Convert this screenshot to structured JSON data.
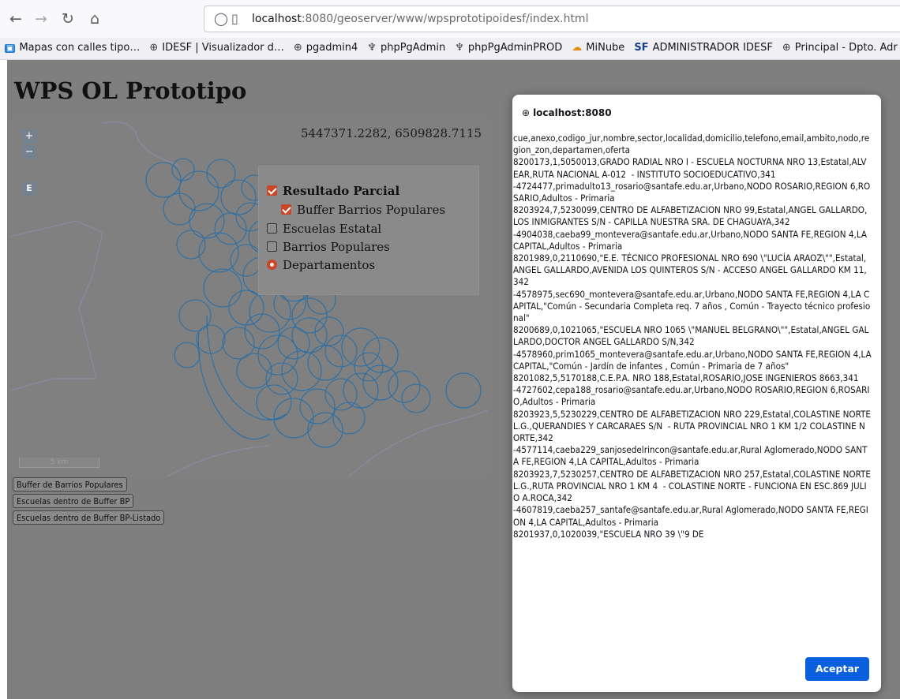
{
  "browser": {
    "url_host": "localhost",
    "url_rest": ":8080/geoserver/www/wpsprototipoidesf/index.html",
    "bookmarks": [
      {
        "label": "Mapas con calles tipo…",
        "icon": "mapas-icon"
      },
      {
        "label": "IDESF | Visualizador d…",
        "icon": "globe-icon"
      },
      {
        "label": "pgadmin4",
        "icon": "globe-icon"
      },
      {
        "label": "phpPgAdmin",
        "icon": "elephant-icon"
      },
      {
        "label": "phpPgAdminPROD",
        "icon": "elephant-icon"
      },
      {
        "label": "MiNube",
        "icon": "minube-icon"
      },
      {
        "label": "ADMINISTRADOR IDESF",
        "icon": "sf-icon"
      },
      {
        "label": "Principal - Dpto. Adr",
        "icon": "globe-icon"
      }
    ]
  },
  "page": {
    "title": "WPS OL Prototipo",
    "coords": "5447371.2282, 6509828.7115",
    "zoom_in": "+",
    "zoom_out": "−",
    "e_button": "E",
    "scale_label": "5 km",
    "layers": {
      "group": "Resultado Parcial",
      "items": [
        {
          "label": "Buffer Barrios Populares",
          "checked": true
        },
        {
          "label": "Escuelas Estatal",
          "checked": false
        },
        {
          "label": "Barrios Populares",
          "checked": false
        },
        {
          "label": "Departamentos",
          "selected": true
        }
      ]
    },
    "buttons": [
      "Buffer de Barrios Populares",
      "Escuelas dentro de Buffer BP",
      "Escuelas dentro de Buffer BP-Listado"
    ]
  },
  "dialog": {
    "host": "localhost:8080",
    "content": "cue,anexo,codigo_jur,nombre,sector,localidad,domicilio,telefono,email,ambito,nodo,region_zon,departamen,oferta\n8200173,1,5050013,GRADO RADIAL NRO I - ESCUELA NOCTURNA NRO 13,Estatal,ALVEAR,RUTA NACIONAL A-012  - INSTITUTO SOCIOEDUCATIVO,341\n-4724477,primadulto13_rosario@santafe.edu.ar,Urbano,NODO ROSARIO,REGION 6,ROSARIO,Adultos - Primaria\n8203924,7,5230099,CENTRO DE ALFABETIZACION NRO 99,Estatal,ANGEL GALLARDO,LOS INMIGRANTES S/N - CAPILLA NUESTRA SRA. DE CHAGUAYA,342\n-4904038,caeba99_montevera@santafe.edu.ar,Urbano,NODO SANTA FE,REGION 4,LA CAPITAL,Adultos - Primaria\n8201989,0,2110690,\"E.E. TÉCNICO PROFESIONAL NRO 690 \\\"LUCÍA ARAOZ\\\"\",Estatal,ANGEL GALLARDO,AVENIDA LOS QUINTEROS S/N - ACCESO ANGEL GALLARDO KM 11,342\n-4578975,sec690_montevera@santafe.edu.ar,Urbano,NODO SANTA FE,REGION 4,LA CAPITAL,\"Común - Secundaria Completa req. 7 años , Común - Trayecto técnico profesional\"\n8200689,0,1021065,\"ESCUELA NRO 1065 \\\"MANUEL BELGRANO\\\"\",Estatal,ANGEL GALLARDO,DOCTOR ANGEL GALLARDO S/N,342\n-4578960,prim1065_montevera@santafe.edu.ar,Urbano,NODO SANTA FE,REGION 4,LA CAPITAL,\"Común - Jardín de infantes , Común - Primaria de 7 años\"\n8201082,5,5170188,C.E.P.A. NRO 188,Estatal,ROSARIO,JOSE INGENIEROS 8663,341\n-4727602,cepa188_rosario@santafe.edu.ar,Urbano,NODO ROSARIO,REGION 6,ROSARIO,Adultos - Primaria\n8203923,5,5230229,CENTRO DE ALFABETIZACION NRO 229,Estatal,COLASTINE NORTE L.G.,QUERANDIES Y CARCARAES S/N  - RUTA PROVINCIAL NRO 1 KM 1/2 COLASTINE NORTE,342\n-4577114,caeba229_sanjosedelrincon@santafe.edu.ar,Rural Aglomerado,NODO SANTA FE,REGION 4,LA CAPITAL,Adultos - Primaria\n8203923,7,5230257,CENTRO DE ALFABETIZACION NRO 257,Estatal,COLASTINE NORTE L.G.,RUTA PROVINCIAL NRO 1 KM 4  - COLASTINE NORTE - FUNCIONA EN ESC.869 JULIO A.ROCA,342\n-4607819,caeba257_santafe@santafe.edu.ar,Rural Aglomerado,NODO SANTA FE,REGION 4,LA CAPITAL,Adultos - Primaria\n8201937,0,1020039,\"ESCUELA NRO 39 \\\"9 DE",
    "accept": "Aceptar"
  },
  "colors": {
    "buffer_stroke": "#2a6fa6",
    "checkbox_accent": "#c8472a",
    "accept_button": "#0a5fdd"
  }
}
